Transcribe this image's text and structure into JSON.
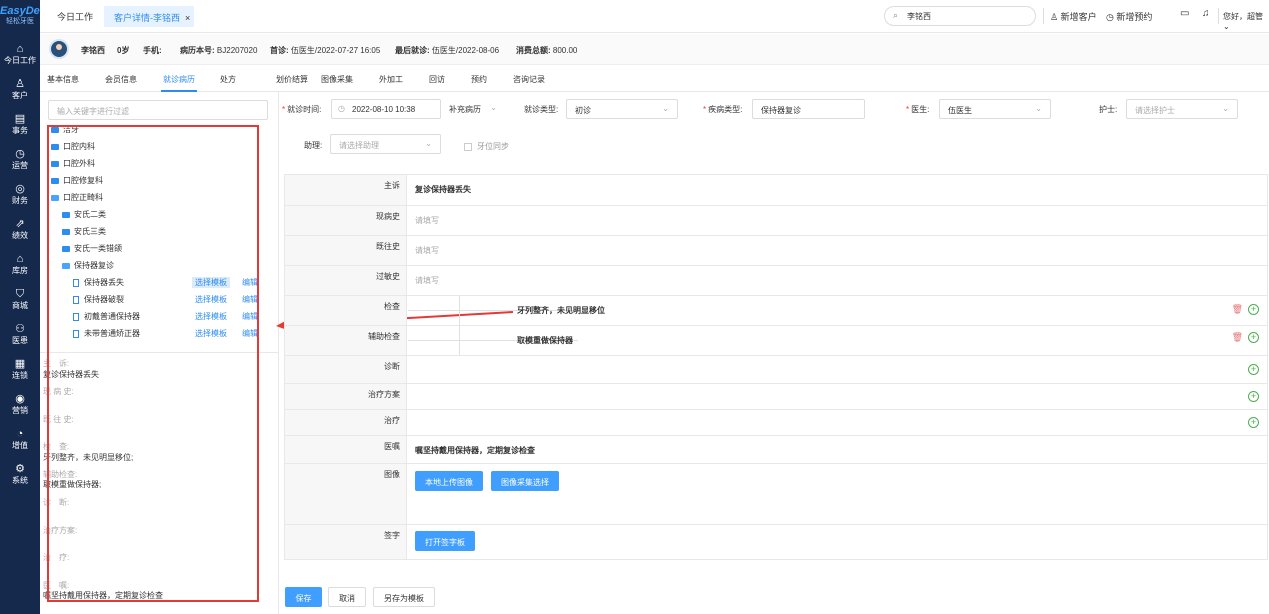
{
  "nav": {
    "logo": "EasyDent",
    "logo_sub": "轻松牙医",
    "items": [
      {
        "icon": "⌂",
        "label": "今日工作"
      },
      {
        "icon": "♙",
        "label": "客户"
      },
      {
        "icon": "▤",
        "label": "事务"
      },
      {
        "icon": "◷",
        "label": "运营"
      },
      {
        "icon": "◎",
        "label": "财务"
      },
      {
        "icon": "⇗",
        "label": "绩效"
      },
      {
        "icon": "⌂",
        "label": "库房"
      },
      {
        "icon": "⛉",
        "label": "商城"
      },
      {
        "icon": "⚇",
        "label": "医患"
      },
      {
        "icon": "▦",
        "label": "连锁"
      },
      {
        "icon": "◉",
        "label": "营销"
      },
      {
        "icon": "◔",
        "label": "增值"
      },
      {
        "icon": "⚙",
        "label": "系统"
      }
    ]
  },
  "topbar": {
    "tab_home": "今日工作",
    "tab_active": "客户详情-李铭西",
    "tab_close": "×",
    "search_value": "李铭西",
    "new_customer": "新增客户",
    "new_appointment": "新增预约",
    "greeting": "您好，超管"
  },
  "patient": {
    "name": "李铭西",
    "age": "0岁",
    "phone_label": "手机:",
    "record_label": "病历本号:",
    "record_no": "BJ2207020",
    "first_label": "首诊:",
    "first_visit": "伍医生/2022-07-27 16:05",
    "last_label": "最后就诊:",
    "last_visit": "伍医生/2022-08-06",
    "total_label": "消费总额:",
    "total": "800.00"
  },
  "subtabs": [
    "基本信息",
    "会员信息",
    "就诊病历",
    "处方",
    "划价结算",
    "图像采集",
    "外加工",
    "回访",
    "预约",
    "咨询记录"
  ],
  "template": {
    "search_placeholder": "输入关键字进行过滤",
    "tree": [
      {
        "label": "洁牙",
        "type": "folder",
        "level": 0
      },
      {
        "label": "口腔内科",
        "type": "folder",
        "level": 0
      },
      {
        "label": "口腔外科",
        "type": "folder",
        "level": 0
      },
      {
        "label": "口腔修复科",
        "type": "folder",
        "level": 0
      },
      {
        "label": "口腔正畸科",
        "type": "folder-open",
        "level": 0
      },
      {
        "label": "安氏二类",
        "type": "folder",
        "level": 1
      },
      {
        "label": "安氏三类",
        "type": "folder",
        "level": 1
      },
      {
        "label": "安氏一类错颌",
        "type": "folder",
        "level": 1
      },
      {
        "label": "保持器复诊",
        "type": "folder-open",
        "level": 1
      },
      {
        "label": "保持器丢失",
        "type": "doc",
        "level": 2
      },
      {
        "label": "保持器破裂",
        "type": "doc",
        "level": 2
      },
      {
        "label": "初戴普通保持器",
        "type": "doc",
        "level": 2
      },
      {
        "label": "未带普通矫正器",
        "type": "doc",
        "level": 2
      }
    ],
    "select_label": "选择模板",
    "edit_label": "编辑",
    "preview": {
      "chief_label": "主　诉:",
      "chief": "复诊保持器丢失",
      "present_label": "现 病 史:",
      "past_label": "既 往 史:",
      "exam_label": "检　查:",
      "exam": "牙列整齐，未见明显移位;",
      "aux_label": "辅助检查:",
      "aux": "取模重做保持器;",
      "diag_label": "诊　断:",
      "plan_label": "治疗方案:",
      "treat_label": "治　疗:",
      "advice_label": "医　嘱:",
      "advice": "嘱坚持戴用保持器，定期复诊检查"
    }
  },
  "form": {
    "visit_time_label": "就诊时间:",
    "visit_time": "2022-08-10 10:38",
    "supplement": "补充病历",
    "visit_type_label": "就诊类型:",
    "visit_type": "初诊",
    "disease_type_label": "疾病类型:",
    "disease_type": "保持器复诊",
    "doctor_label": "医生:",
    "doctor": "伍医生",
    "nurse_label": "护士:",
    "nurse_placeholder": "请选择护士",
    "assistant_label": "助理:",
    "assistant_placeholder": "请选择助理",
    "tooth_sync": "牙位同步"
  },
  "record": {
    "chief_label": "主诉",
    "chief": "复诊保持器丢失",
    "present_label": "现病史",
    "past_label": "既往史",
    "allergy_label": "过敏史",
    "placeholder": "请填写",
    "exam_label": "检查",
    "exam": "牙列整齐，未见明显移位",
    "aux_label": "辅助检查",
    "aux": "取模重做保持器",
    "diag_label": "诊断",
    "plan_label": "治疗方案",
    "treat_label": "治疗",
    "advice_label": "医嘱",
    "advice": "嘱坚持戴用保持器，定期复诊检查",
    "image_label": "图像",
    "upload_btn": "本地上传图像",
    "collect_btn": "图像采集选择",
    "sign_label": "签字",
    "sign_btn": "打开签字板"
  },
  "actions": {
    "save": "保存",
    "cancel": "取消",
    "save_template": "另存为模板"
  }
}
